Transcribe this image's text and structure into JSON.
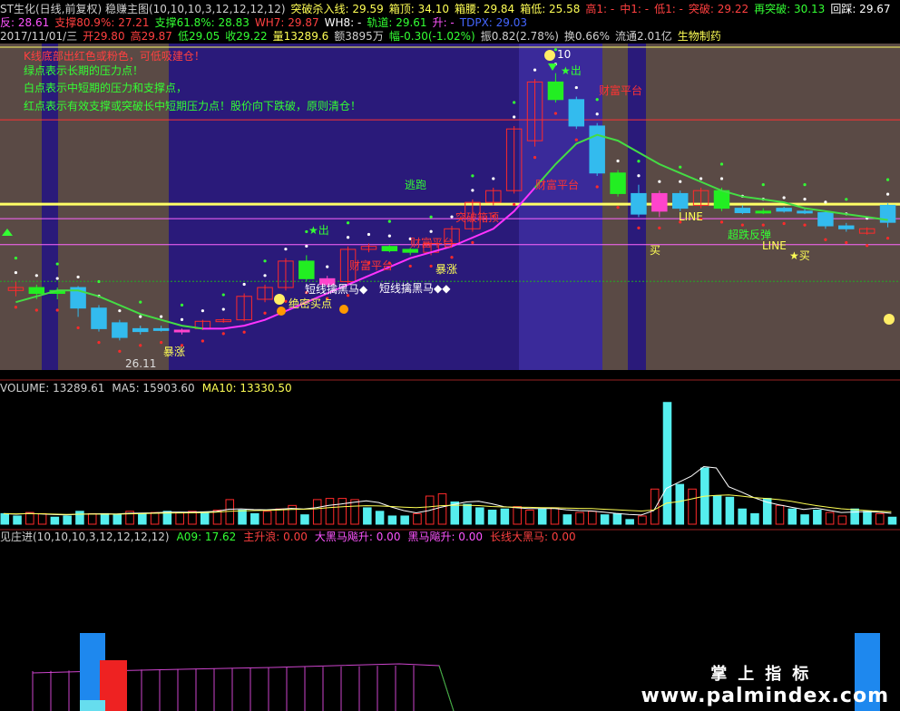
{
  "header": {
    "row1": [
      {
        "text": "ST生化(日线,前复权) 稳赚主图(10,10,10,3,12,12,12,12)",
        "color": "#d0d0d0"
      },
      {
        "text": "突破杀入线: 29.59",
        "color": "#ffff55"
      },
      {
        "text": "箱顶: 34.10",
        "color": "#ffff55"
      },
      {
        "text": "箱腰: 29.84",
        "color": "#ffff55"
      },
      {
        "text": "箱低: 25.58",
        "color": "#ffff55"
      },
      {
        "text": "高1: -",
        "color": "#ff4040"
      },
      {
        "text": "中1: -",
        "color": "#ff4040"
      },
      {
        "text": "低1: -",
        "color": "#ff4040"
      },
      {
        "text": "突破: 29.22",
        "color": "#ff4040"
      },
      {
        "text": "再突破: 30.13",
        "color": "#33ff33"
      },
      {
        "text": "回踩: 29.67",
        "color": "#ffffff"
      }
    ],
    "row2": [
      {
        "text": "反: 28.61",
        "color": "#ff55ff"
      },
      {
        "text": "支撑80.9%: 27.21",
        "color": "#ff4040"
      },
      {
        "text": "支撑61.8%: 28.83",
        "color": "#33ff33"
      },
      {
        "text": "WH7: 29.87",
        "color": "#ff4040"
      },
      {
        "text": "WH8: -",
        "color": "#ffffff"
      },
      {
        "text": "轨道: 29.61",
        "color": "#33ff33"
      },
      {
        "text": "升: -",
        "color": "#ff55ff"
      },
      {
        "text": "TDPX: 29.03",
        "color": "#4466ff"
      }
    ],
    "row3": [
      {
        "text": "2017/11/01/三",
        "color": "#d0d0d0"
      },
      {
        "text": "开29.80",
        "color": "#ff4040"
      },
      {
        "text": "高29.87",
        "color": "#ff4040"
      },
      {
        "text": "低29.05",
        "color": "#33ff33"
      },
      {
        "text": "收29.22",
        "color": "#33ff33"
      },
      {
        "text": "量13289.6",
        "color": "#ffff55"
      },
      {
        "text": "额3895万",
        "color": "#d0d0d0"
      },
      {
        "text": "幅-0.30(-1.02%)",
        "color": "#33ff33"
      },
      {
        "text": "振0.82(2.78%)",
        "color": "#d0d0d0"
      },
      {
        "text": "换0.66%",
        "color": "#d0d0d0"
      },
      {
        "text": "流通2.01亿",
        "color": "#d0d0d0"
      },
      {
        "text": "生物制药",
        "color": "#ffff55"
      }
    ]
  },
  "notes": [
    {
      "text": "K线底部出红色或粉色，可低吸建仓！",
      "color": "#ff4040"
    },
    {
      "text": "绿点表示长期的压力点！",
      "color": "#33ff33"
    },
    {
      "text": "白点表示中短期的压力和支撑点，",
      "color": "#33ff33"
    },
    {
      "text": "红点表示有效支撑或突破长中短期压力点！股价向下跌破，原则清仓！",
      "color": "#33ff33"
    }
  ],
  "annotations": {
    "price_low": "26.11",
    "price_high": "10",
    "bao_zhang_1": "暴涨",
    "bao_zhang_2": "暴涨",
    "chu_1": "★出",
    "chu_2": "★出",
    "mai_1": "买",
    "mai_2": "★买",
    "cai_fu_1": "财富平台",
    "cai_fu_2": "财富平台",
    "cai_fu_3": "财富平台",
    "cai_fu_4": "财富平台",
    "tu_po": "突破箱顶",
    "tao_pao": "逃跑",
    "jue_mi": "绝密买点",
    "duan_xian": "短线擒黑马◆",
    "duan_xian_2": "短线擒黑马◆◆",
    "chao_die": "超跌反弹",
    "line_1": "LINE",
    "line_2": "LINE"
  },
  "volume_panel": {
    "items": [
      {
        "label": "VOLUME: 13289.61",
        "color": "#d0d0d0"
      },
      {
        "label": "MA5: 15903.60",
        "color": "#d0d0d0"
      },
      {
        "label": "MA10: 13330.50",
        "color": "#ffff55"
      }
    ]
  },
  "indicator_panel": {
    "items": [
      {
        "label": "见庄进(10,10,10,3,12,12,12,12)",
        "color": "#d0d0d0"
      },
      {
        "label": "A09: 17.62",
        "color": "#33ff33"
      },
      {
        "label": "主升浪: 0.00",
        "color": "#ff4040"
      },
      {
        "label": "大黑马飚升: 0.00",
        "color": "#ff55ff"
      },
      {
        "label": "黑马飚升: 0.00",
        "color": "#ff55ff"
      },
      {
        "label": "长线大黑马: 0.00",
        "color": "#ff4040"
      }
    ]
  },
  "watermark": {
    "cn": "掌上指标",
    "url": "www.palmindex.com"
  },
  "colors": {
    "bg_dark": "#2a1a7a",
    "bg_grey": "#5a4a45",
    "up": "#ff2a2a",
    "down_cyan": "#33bbee",
    "green": "#22ee22",
    "magenta": "#ff44cc",
    "yellow": "#ffff55"
  },
  "chart_data": [
    {
      "type": "candlestick",
      "title": "",
      "ylim": [
        24.5,
        35
      ],
      "candles": [
        {
          "o": 26.9,
          "h": 27.2,
          "l": 26.7,
          "c": 27.0,
          "color": "red"
        },
        {
          "o": 27.0,
          "h": 27.1,
          "l": 26.6,
          "c": 26.8,
          "color": "green"
        },
        {
          "o": 26.8,
          "h": 27.0,
          "l": 26.6,
          "c": 26.9,
          "color": "green"
        },
        {
          "o": 27.0,
          "h": 27.05,
          "l": 26.0,
          "c": 26.3,
          "color": "cyan"
        },
        {
          "o": 26.3,
          "h": 26.4,
          "l": 25.5,
          "c": 25.6,
          "color": "cyan"
        },
        {
          "o": 25.8,
          "h": 25.9,
          "l": 25.2,
          "c": 25.3,
          "color": "cyan"
        },
        {
          "o": 25.6,
          "h": 25.7,
          "l": 25.4,
          "c": 25.5,
          "color": "cyan"
        },
        {
          "o": 25.6,
          "h": 25.7,
          "l": 25.5,
          "c": 25.6,
          "color": "cyan"
        },
        {
          "o": 25.5,
          "h": 25.6,
          "l": 25.4,
          "c": 25.55,
          "color": "magenta"
        },
        {
          "o": 25.6,
          "h": 25.9,
          "l": 25.55,
          "c": 25.85,
          "color": "red"
        },
        {
          "o": 25.85,
          "h": 25.95,
          "l": 25.8,
          "c": 25.9,
          "color": "red"
        },
        {
          "o": 25.9,
          "h": 26.8,
          "l": 25.85,
          "c": 26.7,
          "color": "red"
        },
        {
          "o": 26.6,
          "h": 27.1,
          "l": 26.5,
          "c": 27.0,
          "color": "red"
        },
        {
          "o": 27.0,
          "h": 28.0,
          "l": 26.9,
          "c": 27.9,
          "color": "red"
        },
        {
          "o": 27.9,
          "h": 28.1,
          "l": 27.2,
          "c": 27.3,
          "color": "green"
        },
        {
          "o": 27.3,
          "h": 27.4,
          "l": 27.0,
          "c": 27.1,
          "color": "magenta"
        },
        {
          "o": 27.2,
          "h": 28.4,
          "l": 27.1,
          "c": 28.3,
          "color": "red"
        },
        {
          "o": 28.3,
          "h": 28.5,
          "l": 28.2,
          "c": 28.4,
          "color": "red"
        },
        {
          "o": 28.4,
          "h": 28.45,
          "l": 28.2,
          "c": 28.25,
          "color": "green"
        },
        {
          "o": 28.3,
          "h": 28.35,
          "l": 28.1,
          "c": 28.2,
          "color": "green"
        },
        {
          "o": 28.2,
          "h": 28.6,
          "l": 28.1,
          "c": 28.5,
          "color": "red"
        },
        {
          "o": 28.5,
          "h": 29.1,
          "l": 28.4,
          "c": 29.0,
          "color": "red"
        },
        {
          "o": 29.0,
          "h": 30.0,
          "l": 28.9,
          "c": 29.9,
          "color": "red"
        },
        {
          "o": 29.9,
          "h": 30.4,
          "l": 29.8,
          "c": 30.3,
          "color": "red"
        },
        {
          "o": 30.3,
          "h": 32.5,
          "l": 30.2,
          "c": 32.4,
          "color": "red"
        },
        {
          "o": 32.0,
          "h": 34.1,
          "l": 31.8,
          "c": 34.0,
          "color": "red"
        },
        {
          "o": 34.0,
          "h": 34.3,
          "l": 33.3,
          "c": 33.4,
          "color": "green"
        },
        {
          "o": 33.4,
          "h": 33.5,
          "l": 32.4,
          "c": 32.5,
          "color": "cyan"
        },
        {
          "o": 32.5,
          "h": 32.6,
          "l": 30.8,
          "c": 30.9,
          "color": "cyan"
        },
        {
          "o": 30.9,
          "h": 31.0,
          "l": 30.1,
          "c": 30.2,
          "color": "green"
        },
        {
          "o": 30.2,
          "h": 30.5,
          "l": 29.4,
          "c": 29.5,
          "color": "cyan"
        },
        {
          "o": 29.6,
          "h": 30.3,
          "l": 29.4,
          "c": 30.2,
          "color": "magenta"
        },
        {
          "o": 30.2,
          "h": 30.3,
          "l": 29.6,
          "c": 29.7,
          "color": "cyan"
        },
        {
          "o": 29.8,
          "h": 30.4,
          "l": 29.7,
          "c": 30.3,
          "color": "red"
        },
        {
          "o": 30.3,
          "h": 30.4,
          "l": 29.6,
          "c": 29.7,
          "color": "green"
        },
        {
          "o": 29.7,
          "h": 29.8,
          "l": 29.5,
          "c": 29.55,
          "color": "cyan"
        },
        {
          "o": 29.6,
          "h": 29.7,
          "l": 29.5,
          "c": 29.6,
          "color": "green"
        },
        {
          "o": 29.7,
          "h": 29.75,
          "l": 29.55,
          "c": 29.6,
          "color": "cyan"
        },
        {
          "o": 29.6,
          "h": 29.7,
          "l": 29.5,
          "c": 29.55,
          "color": "cyan"
        },
        {
          "o": 29.55,
          "h": 29.6,
          "l": 29.0,
          "c": 29.1,
          "color": "cyan"
        },
        {
          "o": 29.1,
          "h": 29.2,
          "l": 28.9,
          "c": 29.0,
          "color": "cyan"
        },
        {
          "o": 29.0,
          "h": 29.05,
          "l": 28.8,
          "c": 28.85,
          "color": "red"
        },
        {
          "o": 29.8,
          "h": 29.87,
          "l": 29.05,
          "c": 29.22,
          "color": "cyan"
        }
      ],
      "ma_line": [
        26.5,
        26.7,
        26.9,
        26.9,
        26.7,
        26.4,
        26.1,
        25.9,
        25.7,
        25.6,
        25.6,
        25.7,
        25.9,
        26.2,
        26.5,
        26.8,
        27.1,
        27.4,
        27.7,
        28.0,
        28.2,
        28.4,
        28.7,
        29.0,
        29.6,
        30.4,
        31.2,
        31.9,
        32.2,
        32.0,
        31.6,
        31.2,
        30.9,
        30.6,
        30.3,
        30.1,
        30.0,
        29.9,
        29.7,
        29.6,
        29.5,
        29.4,
        29.3
      ],
      "levels": {
        "box_top": 34.1,
        "box_mid": 29.84,
        "box_low": 25.58,
        "breakout": 29.59,
        "support_809": 27.21,
        "support_618": 28.83
      }
    },
    {
      "type": "bar",
      "title": "",
      "ylim": [
        0,
        110000
      ],
      "values": [
        9000,
        7000,
        10000,
        9000,
        6000,
        7000,
        11000,
        9000,
        9000,
        8000,
        11000,
        9000,
        10000,
        11000,
        10000,
        11000,
        10000,
        12000,
        21000,
        12000,
        9000,
        11000,
        13000,
        16000,
        8000,
        21000,
        22000,
        22000,
        21000,
        14000,
        11000,
        7000,
        7000,
        9000,
        24000,
        26000,
        19000,
        17000,
        14000,
        12000,
        13000,
        15000,
        12000,
        13000,
        14000,
        8000,
        10000,
        11000,
        8000,
        9000,
        4000,
        7000,
        30000,
        104000,
        34000,
        30000,
        48000,
        24000,
        23000,
        13000,
        9000,
        22000,
        16000,
        13000,
        8000,
        12000,
        10000,
        7000,
        13000,
        11000,
        9000,
        6000
      ],
      "colors": [
        "cyan",
        "cyan",
        "red",
        "red",
        "cyan",
        "cyan",
        "cyan",
        "red",
        "cyan",
        "cyan",
        "red",
        "cyan",
        "red",
        "cyan",
        "red",
        "red",
        "cyan",
        "red",
        "red",
        "cyan",
        "cyan",
        "red",
        "red",
        "red",
        "cyan",
        "red",
        "red",
        "red",
        "red",
        "cyan",
        "cyan",
        "cyan",
        "cyan",
        "red",
        "red",
        "red",
        "cyan",
        "cyan",
        "cyan",
        "cyan",
        "cyan",
        "red",
        "red",
        "cyan",
        "red",
        "cyan",
        "red",
        "red",
        "cyan",
        "cyan",
        "cyan",
        "red",
        "red",
        "cyan",
        "cyan",
        "red",
        "cyan",
        "cyan",
        "cyan",
        "cyan",
        "cyan",
        "cyan",
        "red",
        "cyan",
        "cyan",
        "cyan",
        "red",
        "red",
        "cyan",
        "cyan",
        "red",
        "cyan"
      ],
      "ma5": [
        9000,
        8500,
        9200,
        8700,
        8200,
        8000,
        8500,
        8800,
        8900,
        8700,
        9300,
        9500,
        9700,
        10300,
        10400,
        10200,
        10500,
        10900,
        12800,
        13100,
        12500,
        12300,
        12800,
        13500,
        12900,
        14200,
        16100,
        17300,
        18700,
        19900,
        18500,
        14700,
        11600,
        9700,
        11600,
        14600,
        16800,
        19000,
        19600,
        17500,
        15000,
        14000,
        13300,
        13300,
        13500,
        12300,
        11600,
        11300,
        10300,
        9200,
        8400,
        7800,
        11600,
        30600,
        35800,
        41000,
        49200,
        48000,
        32000,
        27600,
        22800,
        19000,
        16600,
        14600,
        12600,
        13800,
        11800,
        10000,
        10400,
        10800,
        10200,
        9300
      ],
      "ma10": [
        9000,
        8800,
        9000,
        8900,
        8600,
        8400,
        8500,
        8600,
        8600,
        8500,
        8800,
        9000,
        9300,
        9500,
        9600,
        9700,
        9900,
        10200,
        11000,
        11500,
        11600,
        11800,
        12100,
        12600,
        12800,
        13200,
        14100,
        14800,
        15400,
        15800,
        15600,
        15100,
        14600,
        14200,
        14800,
        15800,
        16200,
        16200,
        15900,
        15100,
        14700,
        14600,
        14400,
        14200,
        14000,
        13700,
        13500,
        13300,
        12800,
        12300,
        11700,
        11200,
        12100,
        17900,
        19300,
        21500,
        23800,
        24600,
        25000,
        24000,
        22800,
        22000,
        21000,
        19500,
        17600,
        15900,
        14400,
        13200,
        12400,
        11700,
        11000,
        10600
      ]
    }
  ]
}
